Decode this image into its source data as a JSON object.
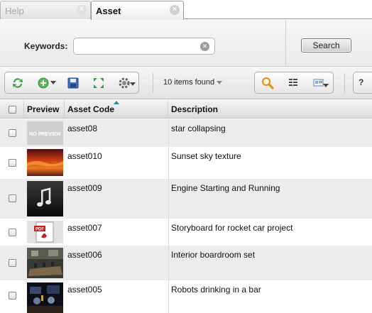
{
  "tabs": [
    {
      "label": "Help",
      "active": false
    },
    {
      "label": "Asset",
      "active": true
    }
  ],
  "search": {
    "keywords_label": "Keywords:",
    "keywords_value": "",
    "search_button": "Search"
  },
  "toolbar": {
    "items_found": "10 items found",
    "help_label": "?",
    "icons": [
      "refresh-icon",
      "add-icon",
      "save-icon",
      "expand-icon",
      "settings-icon",
      "search-icon",
      "list-view-icon",
      "card-view-icon"
    ]
  },
  "table": {
    "columns": [
      "Preview",
      "Asset Code",
      "Description"
    ],
    "sort_column": "Asset Code",
    "rows": [
      {
        "code": "asset08",
        "description": "star collapsing",
        "preview": "NO PREVIEW"
      },
      {
        "code": "asset010",
        "description": "Sunset sky texture",
        "preview": ""
      },
      {
        "code": "asset009",
        "description": "Engine Starting and Running",
        "preview": ""
      },
      {
        "code": "asset007",
        "description": "Storyboard for rocket car project",
        "preview": ""
      },
      {
        "code": "asset006",
        "description": "Interior boardroom set",
        "preview": ""
      },
      {
        "code": "asset005",
        "description": "Robots drinking in a bar",
        "preview": ""
      }
    ]
  },
  "colors": {
    "accent_sort": "#2a8f8f",
    "row_alt": "#ececec",
    "border": "#b0b0b0"
  }
}
